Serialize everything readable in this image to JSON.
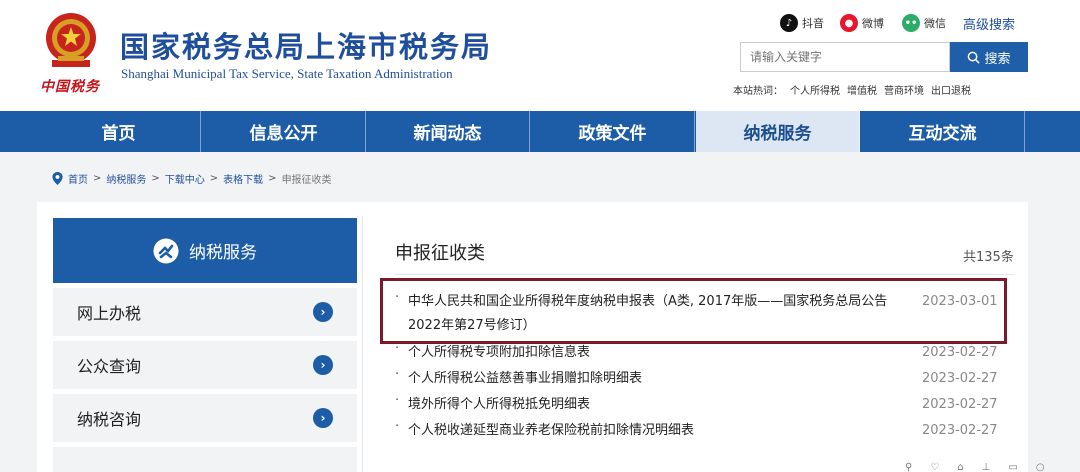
{
  "header": {
    "title": "国家税务总局上海市税务局",
    "subtitle": "Shanghai Municipal Tax Service, State Taxation Administration",
    "seal_text": "中国税务",
    "social": [
      {
        "icon": "douyin-icon",
        "label": "抖音",
        "color": "#111111"
      },
      {
        "icon": "weibo-icon",
        "label": "微博",
        "color": "#e6162d"
      },
      {
        "icon": "wechat-icon",
        "label": "微信",
        "color": "#2aae67"
      }
    ],
    "advanced_search": "高级搜索",
    "search_placeholder": "请输入关键字",
    "search_button": "搜索",
    "hot_label": "本站热词：",
    "hot_words": [
      "个人所得税",
      "增值税",
      "营商环境",
      "出口退税"
    ]
  },
  "nav": {
    "items": [
      "首页",
      "信息公开",
      "新闻动态",
      "政策文件",
      "纳税服务",
      "互动交流"
    ],
    "active": "纳税服务"
  },
  "breadcrumb": {
    "items": [
      "首页",
      "纳税服务",
      "下载中心",
      "表格下载"
    ],
    "current": "申报征收类"
  },
  "sidebar": {
    "heading": "纳税服务",
    "items": [
      "网上办税",
      "公众查询",
      "纳税咨询"
    ]
  },
  "main": {
    "section_title": "申报征收类",
    "total": "共135条",
    "rows": [
      {
        "title": "中华人民共和国企业所得税年度纳税申报表（A类, 2017年版——国家税务总局公告2022年第27号修订）",
        "date": "2023-03-01"
      },
      {
        "title": "个人所得税专项附加扣除信息表",
        "date": "2023-02-27"
      },
      {
        "title": "个人所得税公益慈善事业捐赠扣除明细表",
        "date": "2023-02-27"
      },
      {
        "title": "境外所得个人所得税抵免明细表",
        "date": "2023-02-27"
      },
      {
        "title": "个人税收递延型商业养老保险税前扣除情况明细表",
        "date": "2023-02-27"
      }
    ]
  },
  "colors": {
    "brand_blue": "#1d5ca6",
    "highlight_border": "#7a1b2d"
  }
}
